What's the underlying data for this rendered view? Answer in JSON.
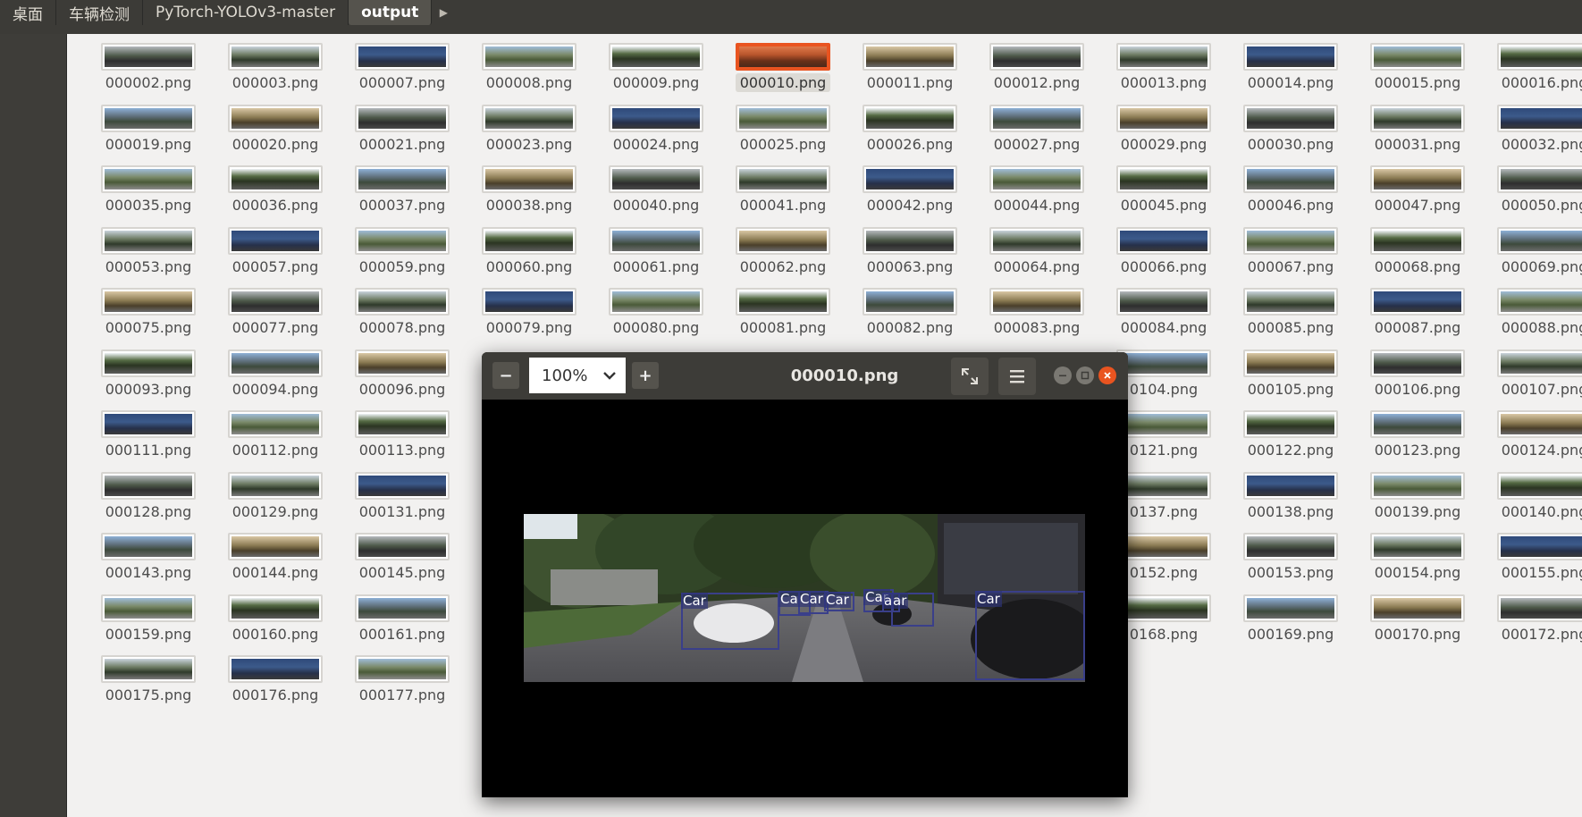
{
  "breadcrumb": [
    "桌面",
    "车辆检测",
    "PyTorch-YOLOv3-master",
    "output"
  ],
  "files": [
    "000002.png",
    "000003.png",
    "000007.png",
    "000008.png",
    "000009.png",
    "000010.png",
    "000011.png",
    "000012.png",
    "000013.png",
    "000014.png",
    "000015.png",
    "000016.png",
    "000019.png",
    "000020.png",
    "000021.png",
    "000023.png",
    "000024.png",
    "000025.png",
    "000026.png",
    "000027.png",
    "000029.png",
    "000030.png",
    "000031.png",
    "000032.png",
    "000035.png",
    "000036.png",
    "000037.png",
    "000038.png",
    "000040.png",
    "000041.png",
    "000042.png",
    "000044.png",
    "000045.png",
    "000046.png",
    "000047.png",
    "000050.png",
    "000053.png",
    "000057.png",
    "000059.png",
    "000060.png",
    "000061.png",
    "000062.png",
    "000063.png",
    "000064.png",
    "000066.png",
    "000067.png",
    "000068.png",
    "000069.png",
    "000075.png",
    "000077.png",
    "000078.png",
    "000079.png",
    "000080.png",
    "000081.png",
    "000082.png",
    "000083.png",
    "000084.png",
    "000085.png",
    "000087.png",
    "000088.png",
    "000093.png",
    "000094.png",
    "000096.png",
    "",
    "",
    "",
    "",
    "",
    "0104.png",
    "000105.png",
    "000106.png",
    "000107.png",
    "000111.png",
    "000112.png",
    "000113.png",
    "",
    "",
    "",
    "",
    "",
    "0121.png",
    "000122.png",
    "000123.png",
    "000124.png",
    "000128.png",
    "000129.png",
    "000131.png",
    "",
    "",
    "",
    "",
    "",
    "0137.png",
    "000138.png",
    "000139.png",
    "000140.png",
    "000143.png",
    "000144.png",
    "000145.png",
    "",
    "",
    "",
    "",
    "",
    "0152.png",
    "000153.png",
    "000154.png",
    "000155.png",
    "000159.png",
    "000160.png",
    "000161.png",
    "",
    "",
    "",
    "",
    "",
    "0168.png",
    "000169.png",
    "000170.png",
    "000172.png",
    "000175.png",
    "000176.png",
    "000177.png"
  ],
  "selected_file": "000010.png",
  "viewer": {
    "title": "000010.png",
    "zoom": "100%",
    "zoom_out": "−",
    "zoom_in": "+",
    "detections": [
      "Car",
      "Ca",
      "Car",
      "Car",
      "Car",
      "a",
      "ar",
      "Car"
    ]
  },
  "colors": {
    "accent": "#e95420",
    "box": "#3a3f8a"
  }
}
